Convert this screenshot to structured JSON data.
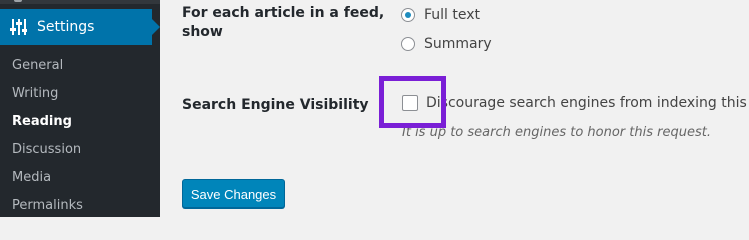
{
  "sidebar": {
    "settings_label": "Settings",
    "items": [
      {
        "label": "General"
      },
      {
        "label": "Writing"
      },
      {
        "label": "Reading"
      },
      {
        "label": "Discussion"
      },
      {
        "label": "Media"
      },
      {
        "label": "Permalinks"
      }
    ],
    "active_item": "Reading"
  },
  "feed_article": {
    "label_line1": "For each article in a feed,",
    "label_line2": "show",
    "options": [
      {
        "label": "Full text",
        "checked": true
      },
      {
        "label": "Summary",
        "checked": false
      }
    ]
  },
  "search_engine_visibility": {
    "label": "Search Engine Visibility",
    "checkbox_label": "Discourage search engines from indexing this site",
    "checked": false,
    "hint": "It is up to search engines to honor this request."
  },
  "save_button": {
    "label": "Save Changes"
  },
  "colors": {
    "sidebar_bg": "#23282d",
    "accent": "#0073aa",
    "button_bg": "#0085ba",
    "highlight": "#7a1fd6"
  }
}
